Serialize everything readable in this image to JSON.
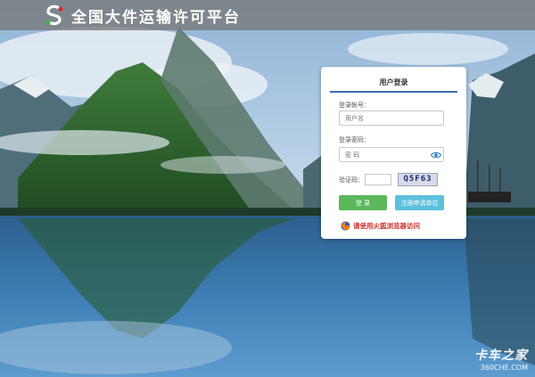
{
  "header": {
    "title": "全国大件运输许可平台"
  },
  "login": {
    "title": "用户登录",
    "account_label": "登录帐号：",
    "account_placeholder": "用户名",
    "password_label": "登录密码：",
    "password_placeholder": "密 码",
    "captcha_label": "验证码：",
    "captcha_value": "",
    "captcha_text": "Q5F63",
    "login_button": "登 录",
    "register_button": "注册申请单位",
    "browser_note": "请使用火狐浏览器访问"
  },
  "watermark": {
    "main": "卡车之家",
    "sub": "360CHE.COM"
  },
  "colors": {
    "accent": "#3e6fb0",
    "login_button": "#5cb85c",
    "register_button": "#5bc0de",
    "note_red": "#c9302c"
  }
}
